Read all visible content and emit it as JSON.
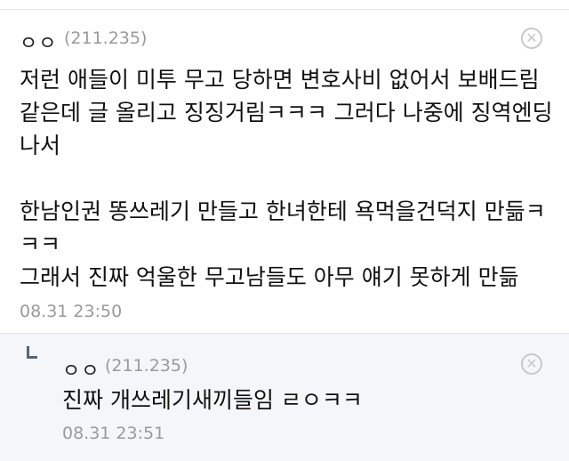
{
  "comment": {
    "nickname": "ㅇㅇ",
    "ip": "(211.235)",
    "text": "저런 애들이 미투 무고 당하면 변호사비 없어서 보배드림같은데 글 올리고 징징거림ㅋㅋㅋ 그러다 나중에 징역엔딩 나서\n\n한남인권 똥쓰레기 만들고 한녀한테 욕먹을건덕지 만듦ㅋㅋㅋ\n그래서 진짜 억울한 무고남들도 아무 얘기 못하게 만듦",
    "time": "08.31 23:50",
    "close_icon": "✕"
  },
  "reply": {
    "nickname": "ㅇㅇ",
    "ip": "(211.235)",
    "text": "진짜 개쓰레기새끼들임 ㄹㅇㅋㅋ",
    "time": "08.31 23:51",
    "close_icon": "✕"
  }
}
